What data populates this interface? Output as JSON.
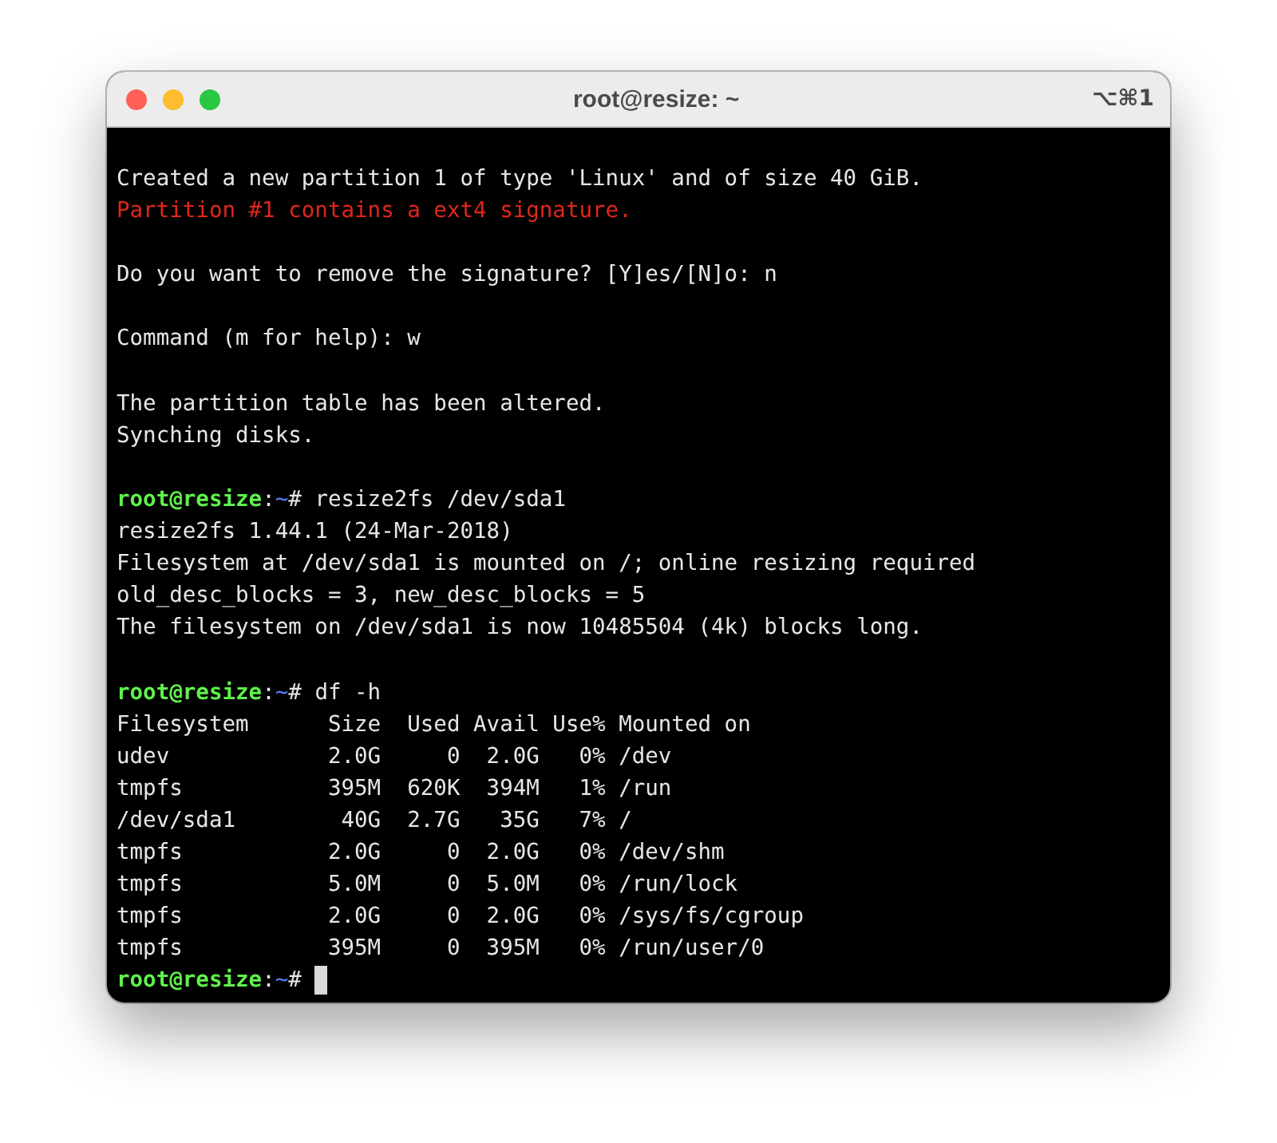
{
  "window": {
    "title": "root@resize: ~",
    "shortcut": "⌥⌘1"
  },
  "lines": [
    {
      "kind": "output",
      "text": "Created a new partition 1 of type 'Linux' and of size 40 GiB."
    },
    {
      "kind": "error",
      "text": "Partition #1 contains a ext4 signature."
    },
    {
      "kind": "blank"
    },
    {
      "kind": "output",
      "text": "Do you want to remove the signature? [Y]es/[N]o: n"
    },
    {
      "kind": "blank"
    },
    {
      "kind": "output",
      "text": "Command (m for help): w"
    },
    {
      "kind": "blank"
    },
    {
      "kind": "output",
      "text": "The partition table has been altered."
    },
    {
      "kind": "output",
      "text": "Synching disks."
    },
    {
      "kind": "blank"
    },
    {
      "kind": "prompt",
      "user": "root@resize",
      "separator": ":",
      "path": "~",
      "symbol": "#",
      "command": "resize2fs /dev/sda1"
    },
    {
      "kind": "output",
      "text": "resize2fs 1.44.1 (24-Mar-2018)"
    },
    {
      "kind": "output",
      "text": "Filesystem at /dev/sda1 is mounted on /; online resizing required"
    },
    {
      "kind": "output",
      "text": "old_desc_blocks = 3, new_desc_blocks = 5"
    },
    {
      "kind": "output",
      "text": "The filesystem on /dev/sda1 is now 10485504 (4k) blocks long."
    },
    {
      "kind": "blank"
    },
    {
      "kind": "prompt",
      "user": "root@resize",
      "separator": ":",
      "path": "~",
      "symbol": "#",
      "command": "df -h"
    },
    {
      "kind": "output",
      "text": "Filesystem      Size  Used Avail Use% Mounted on"
    },
    {
      "kind": "output",
      "text": "udev            2.0G     0  2.0G   0% /dev"
    },
    {
      "kind": "output",
      "text": "tmpfs           395M  620K  394M   1% /run"
    },
    {
      "kind": "output",
      "text": "/dev/sda1        40G  2.7G   35G   7% /"
    },
    {
      "kind": "output",
      "text": "tmpfs           2.0G     0  2.0G   0% /dev/shm"
    },
    {
      "kind": "output",
      "text": "tmpfs           5.0M     0  5.0M   0% /run/lock"
    },
    {
      "kind": "output",
      "text": "tmpfs           2.0G     0  2.0G   0% /sys/fs/cgroup"
    },
    {
      "kind": "output",
      "text": "tmpfs           395M     0  395M   0% /run/user/0"
    },
    {
      "kind": "prompt",
      "user": "root@resize",
      "separator": ":",
      "path": "~",
      "symbol": "#",
      "cursor": true
    }
  ]
}
